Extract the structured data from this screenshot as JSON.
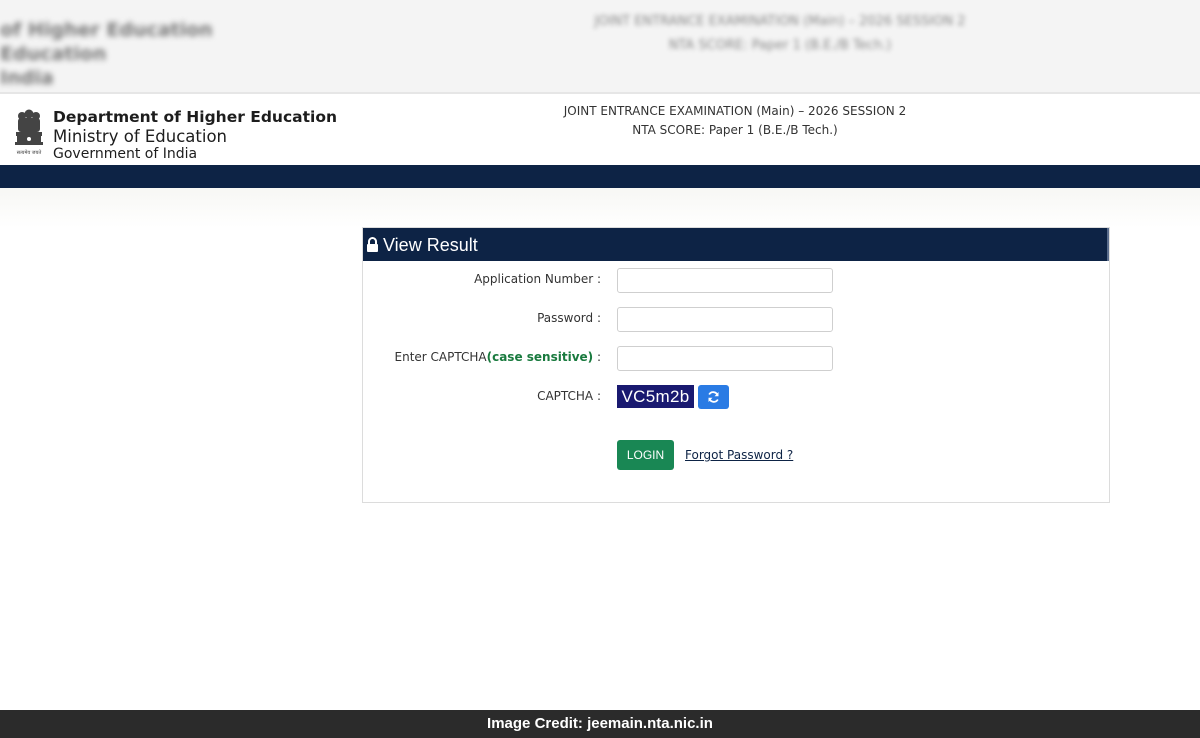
{
  "ghost": {
    "left_line1": "of Higher Education",
    "left_line2": "Education",
    "left_line3": "India",
    "center_line1": "JOINT ENTRANCE EXAMINATION (Main) – 2026 SESSION 2",
    "center_line2": "NTA SCORE: Paper 1 (B.E./B Tech.)"
  },
  "header": {
    "dept_line1": "Department of Higher Education",
    "dept_line2": "Ministry of Education",
    "dept_line3": "Government of India",
    "emblem_caption": "सत्यमेव जयते",
    "exam_line1": "JOINT ENTRANCE EXAMINATION (Main) – 2026 SESSION 2",
    "exam_line2": "NTA SCORE: Paper 1 (B.E./B Tech.)"
  },
  "panel": {
    "title": "View Result",
    "application_label": "Application Number :",
    "application_value": "",
    "password_label": "Password :",
    "password_value": "",
    "captcha_input_label_prefix": "Enter CAPTCHA",
    "captcha_input_label_note": "(case sensitive)",
    "captcha_input_label_suffix": " :",
    "captcha_input_value": "",
    "captcha_label": "CAPTCHA :",
    "captcha_text": "VC5m2b",
    "login_label": "LOGIN",
    "forgot_label": "Forgot Password ?"
  },
  "footer": {
    "credit": "Image Credit: jeemain.nta.nic.in"
  },
  "colors": {
    "navy": "#0d2345",
    "captcha_bg": "#191970",
    "login_green": "#198754",
    "refresh_blue": "#2a7be4",
    "case_sensitive_green": "#197a3e"
  },
  "icons": {
    "emblem": "state-emblem-icon",
    "lock": "lock-icon",
    "refresh": "refresh-icon"
  }
}
